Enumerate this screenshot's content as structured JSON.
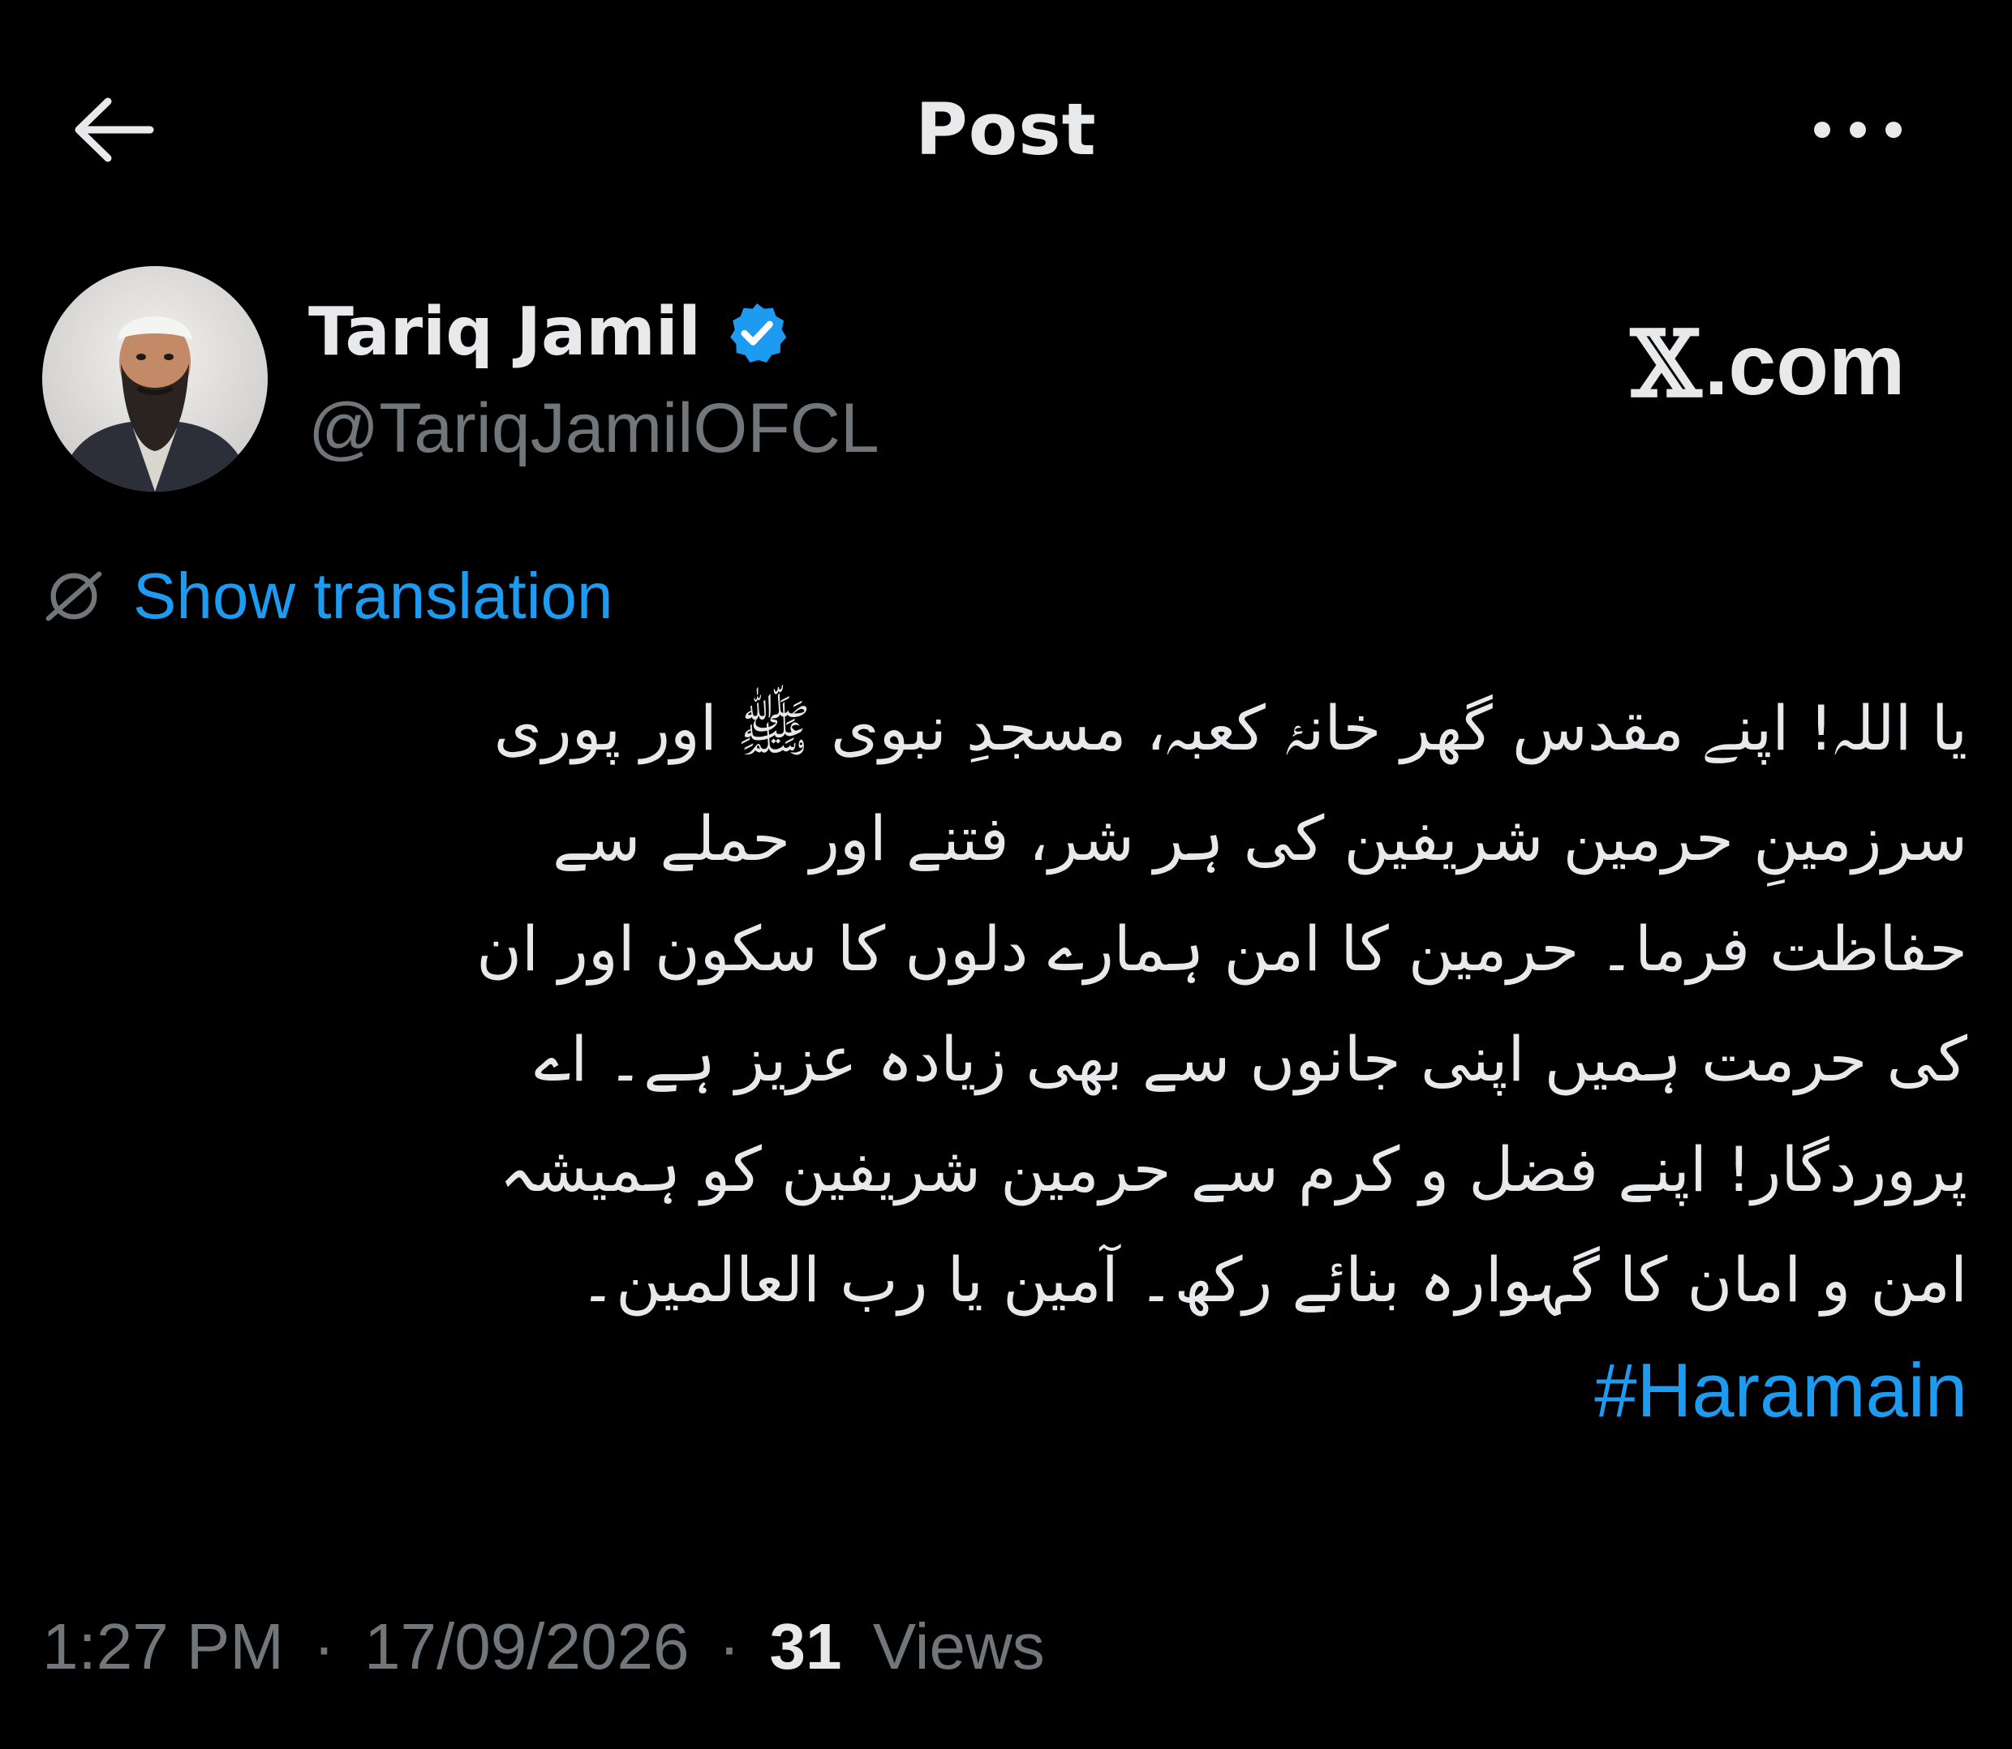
{
  "header": {
    "title": "Post",
    "back_icon": "arrow-left-icon",
    "more_icon": "more-horizontal-icon"
  },
  "author": {
    "name": "Tariq Jamil",
    "handle": "@TariqJamilOFCL",
    "verified": true,
    "verified_icon": "verified-badge-icon",
    "avatar": "avatar"
  },
  "brand": {
    "x_glyph": "𝕏",
    "domain": ".com"
  },
  "translation": {
    "label": "Show translation",
    "icon": "translate-globe-icon"
  },
  "post": {
    "lines": [
      "یا اللہ! اپنے مقدس گھر خانۂ کعبہ، مسجدِ نبوی ﷺ اور پوری",
      "سرزمینِ حرمین شریفین کی ہر شر، فتنے اور حملے سے",
      "حفاظت فرما۔ حرمین کا امن ہمارے دلوں کا سکون اور ان",
      "کی حرمت ہمیں اپنی جانوں سے بھی زیادہ عزیز ہے۔ اے",
      "پروردگار! اپنے فضل و کرم سے حرمین شریفین کو ہمیشہ",
      "امن و امان کا گہوارہ بنائے رکھ۔ آمین یا رب العالمین۔"
    ],
    "hashtag": "#Haramain"
  },
  "meta": {
    "time": "1:27 PM",
    "separator": "·",
    "date": "17/09/2026",
    "views_count": "31",
    "views_label": "Views"
  },
  "colors": {
    "background": "#000000",
    "text": "#e7e9ea",
    "secondary": "#71767b",
    "accent": "#1d9bf0"
  }
}
